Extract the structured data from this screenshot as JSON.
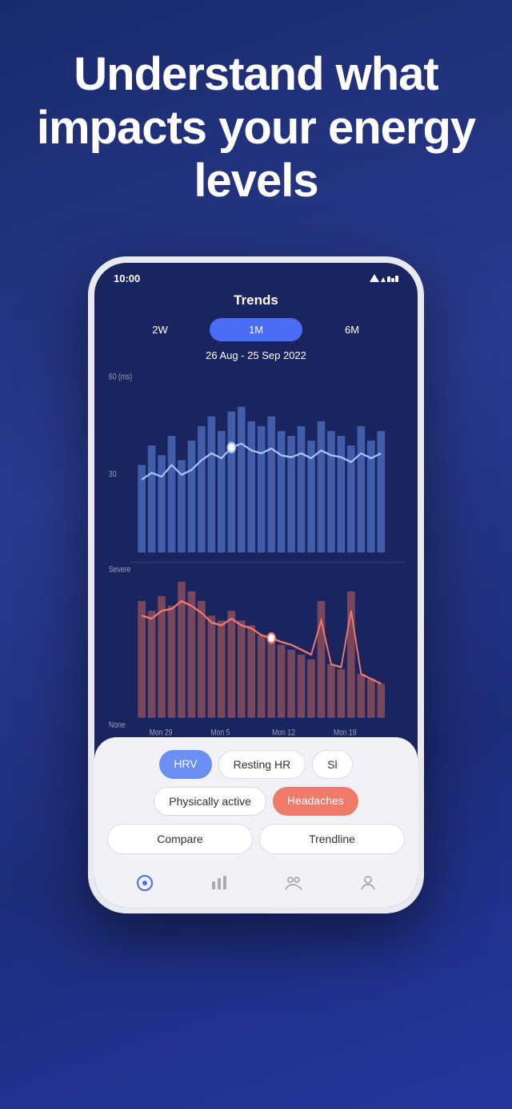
{
  "hero": {
    "title": "Understand what impacts your energy levels"
  },
  "status_bar": {
    "time": "10:00",
    "icons": "▲▼▮"
  },
  "screen": {
    "title": "Trends",
    "tabs": [
      {
        "label": "2W",
        "active": false
      },
      {
        "label": "1M",
        "active": true
      },
      {
        "label": "6M",
        "active": false
      }
    ],
    "date_range": "26 Aug - 25 Sep 2022",
    "chart": {
      "y_label_top": "60 (ms)",
      "y_label_mid": "30",
      "y_label_severe": "Severe",
      "y_label_none": "None",
      "x_labels": [
        "Mon 29",
        "Mon 5",
        "Mon 12",
        "Mon 19"
      ]
    }
  },
  "filters": {
    "row1": [
      {
        "label": "HRV",
        "style": "blue"
      },
      {
        "label": "Resting HR",
        "style": "outline"
      },
      {
        "label": "Sl",
        "style": "outline"
      }
    ],
    "row2": [
      {
        "label": "Physically active",
        "style": "outline"
      },
      {
        "label": "Headaches",
        "style": "salmon"
      }
    ]
  },
  "actions": [
    {
      "label": "Compare"
    },
    {
      "label": "Trendline"
    }
  ],
  "nav": [
    {
      "icon": "◎",
      "active": true
    },
    {
      "icon": "▦",
      "active": false
    },
    {
      "icon": "⚇",
      "active": false
    },
    {
      "icon": "⊙",
      "active": false
    }
  ]
}
